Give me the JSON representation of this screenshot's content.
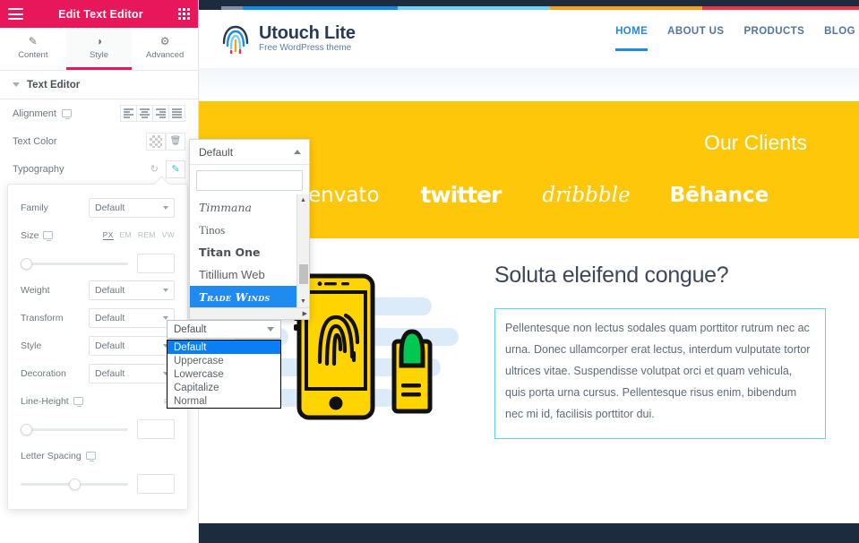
{
  "panel": {
    "header": {
      "title": "Edit Text Editor",
      "menu_icon": "hamburger-icon",
      "grid_icon": "widgets-grid-icon"
    },
    "tabs": [
      {
        "label": "Content",
        "icon": "pencil-icon",
        "active": false
      },
      {
        "label": "Style",
        "icon": "contrast-icon",
        "active": true
      },
      {
        "label": "Advanced",
        "icon": "gear-icon",
        "active": false
      }
    ],
    "section": {
      "title": "Text Editor",
      "toggle_icon": "caret-down-icon"
    },
    "controls": [
      {
        "label": "Alignment",
        "device_icon": "desktop-icon",
        "options": [
          "align-left",
          "align-center",
          "align-right",
          "align-justify"
        ]
      },
      {
        "label": "Text Color",
        "swatch": "transparent-checker",
        "clear_icon": "trash-icon"
      },
      {
        "label": "Typography",
        "reset_icon": "reset-icon",
        "edit_icon": "pencil-icon"
      }
    ],
    "typography": {
      "family": {
        "label": "Family",
        "value": "Default"
      },
      "size": {
        "label": "Size",
        "device_icon": "desktop-icon",
        "units": [
          "PX",
          "EM",
          "REM",
          "VW"
        ],
        "active_unit": "PX",
        "value": ""
      },
      "weight": {
        "label": "Weight",
        "value": "Default"
      },
      "transform": {
        "label": "Transform",
        "value": "Default"
      },
      "style": {
        "label": "Style",
        "value": "Default"
      },
      "decoration": {
        "label": "Decoration",
        "value": "Default"
      },
      "line_height": {
        "label": "Line-Height",
        "device_icon": "desktop-icon",
        "unit": "PX",
        "value": ""
      },
      "letter_spacing": {
        "label": "Letter Spacing",
        "device_icon": "desktop-icon",
        "value": ""
      }
    }
  },
  "font_dropdown": {
    "selected_display": "Default",
    "arrow_icon": "caret-up-icon",
    "search_value": "",
    "search_placeholder": "",
    "items": [
      {
        "label": "Timmana",
        "selected": false
      },
      {
        "label": "Tinos",
        "selected": false
      },
      {
        "label": "Titan One",
        "selected": false
      },
      {
        "label": "Titillium Web",
        "selected": false
      },
      {
        "label": "Trade Winds",
        "selected": true
      }
    ]
  },
  "transform_select": {
    "value": "Default",
    "options": [
      {
        "label": "Default",
        "selected": true
      },
      {
        "label": "Uppercase",
        "selected": false
      },
      {
        "label": "Lowercase",
        "selected": false
      },
      {
        "label": "Capitalize",
        "selected": false
      },
      {
        "label": "Normal",
        "selected": false
      }
    ]
  },
  "site": {
    "topbar_colors": [
      "#1d2b3e",
      "#7e8fa6",
      "#0a8ce8",
      "#6ed3f2",
      "#f5a316",
      "#f03147"
    ],
    "logo": {
      "name": "Utouch Lite",
      "tagline": "Free WordPress theme",
      "icon": "fingerprint-logo-icon"
    },
    "nav": [
      {
        "label": "HOME",
        "active": true
      },
      {
        "label": "ABOUT US",
        "active": false
      },
      {
        "label": "PRODUCTS",
        "active": false
      },
      {
        "label": "BLOG",
        "active": false
      }
    ],
    "clients": {
      "title": "Our Clients",
      "bg_color": "#ffc709",
      "logos": [
        "envato",
        "twitter",
        "dribbble",
        "Bēhance"
      ]
    },
    "illustration": {
      "icon": "phone-fingerprint-illustration",
      "phone_color": "#ffd400",
      "finger_color": "#00c853"
    },
    "heading": "Soluta eleifend congue?",
    "paragraph": "Pellentesque non lectus sodales quam porttitor rutrum nec ac urna. Donec ullamcorper erat lectus, interdum vulputate tortor ultrices vitae. Suspendisse volutpat orci et quam vehicula, quis porta urna cursus. Pellentesque risus enim, bibendum nec mi id, facilisis porttitor dui.",
    "selection_color": "#57d7e8"
  }
}
